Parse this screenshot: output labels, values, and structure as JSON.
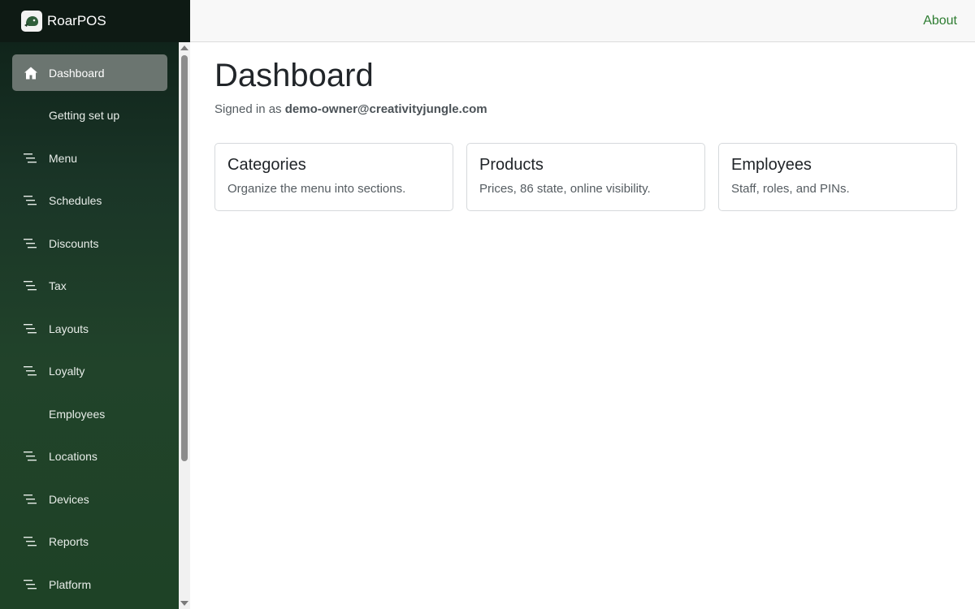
{
  "brand": {
    "name": "RoarPOS"
  },
  "topbar": {
    "about_label": "About"
  },
  "sidebar": {
    "items": [
      {
        "label": "Dashboard",
        "icon": "home-icon",
        "active": true
      },
      {
        "label": "Getting set up",
        "icon": ""
      },
      {
        "label": "Menu",
        "icon": "lines-icon"
      },
      {
        "label": "Schedules",
        "icon": "lines-icon"
      },
      {
        "label": "Discounts",
        "icon": "lines-icon"
      },
      {
        "label": "Tax",
        "icon": "lines-icon"
      },
      {
        "label": "Layouts",
        "icon": "lines-icon"
      },
      {
        "label": "Loyalty",
        "icon": "lines-icon"
      },
      {
        "label": "Employees",
        "icon": ""
      },
      {
        "label": "Locations",
        "icon": "lines-icon"
      },
      {
        "label": "Devices",
        "icon": "lines-icon"
      },
      {
        "label": "Reports",
        "icon": "lines-icon"
      },
      {
        "label": "Platform",
        "icon": "lines-icon"
      }
    ]
  },
  "main": {
    "title": "Dashboard",
    "signed_in_prefix": "Signed in as",
    "user_email": "demo-owner@creativityjungle.com",
    "cards": [
      {
        "title": "Categories",
        "description": "Organize the menu into sections."
      },
      {
        "title": "Products",
        "description": "Prices, 86 state, online visibility."
      },
      {
        "title": "Employees",
        "description": "Staff, roles, and PINs."
      }
    ]
  },
  "colors": {
    "accent": "#2e7d32",
    "sidebar_dark": "#0e1a14",
    "sidebar_green": "#21432a",
    "active_item": "#6b7570"
  }
}
